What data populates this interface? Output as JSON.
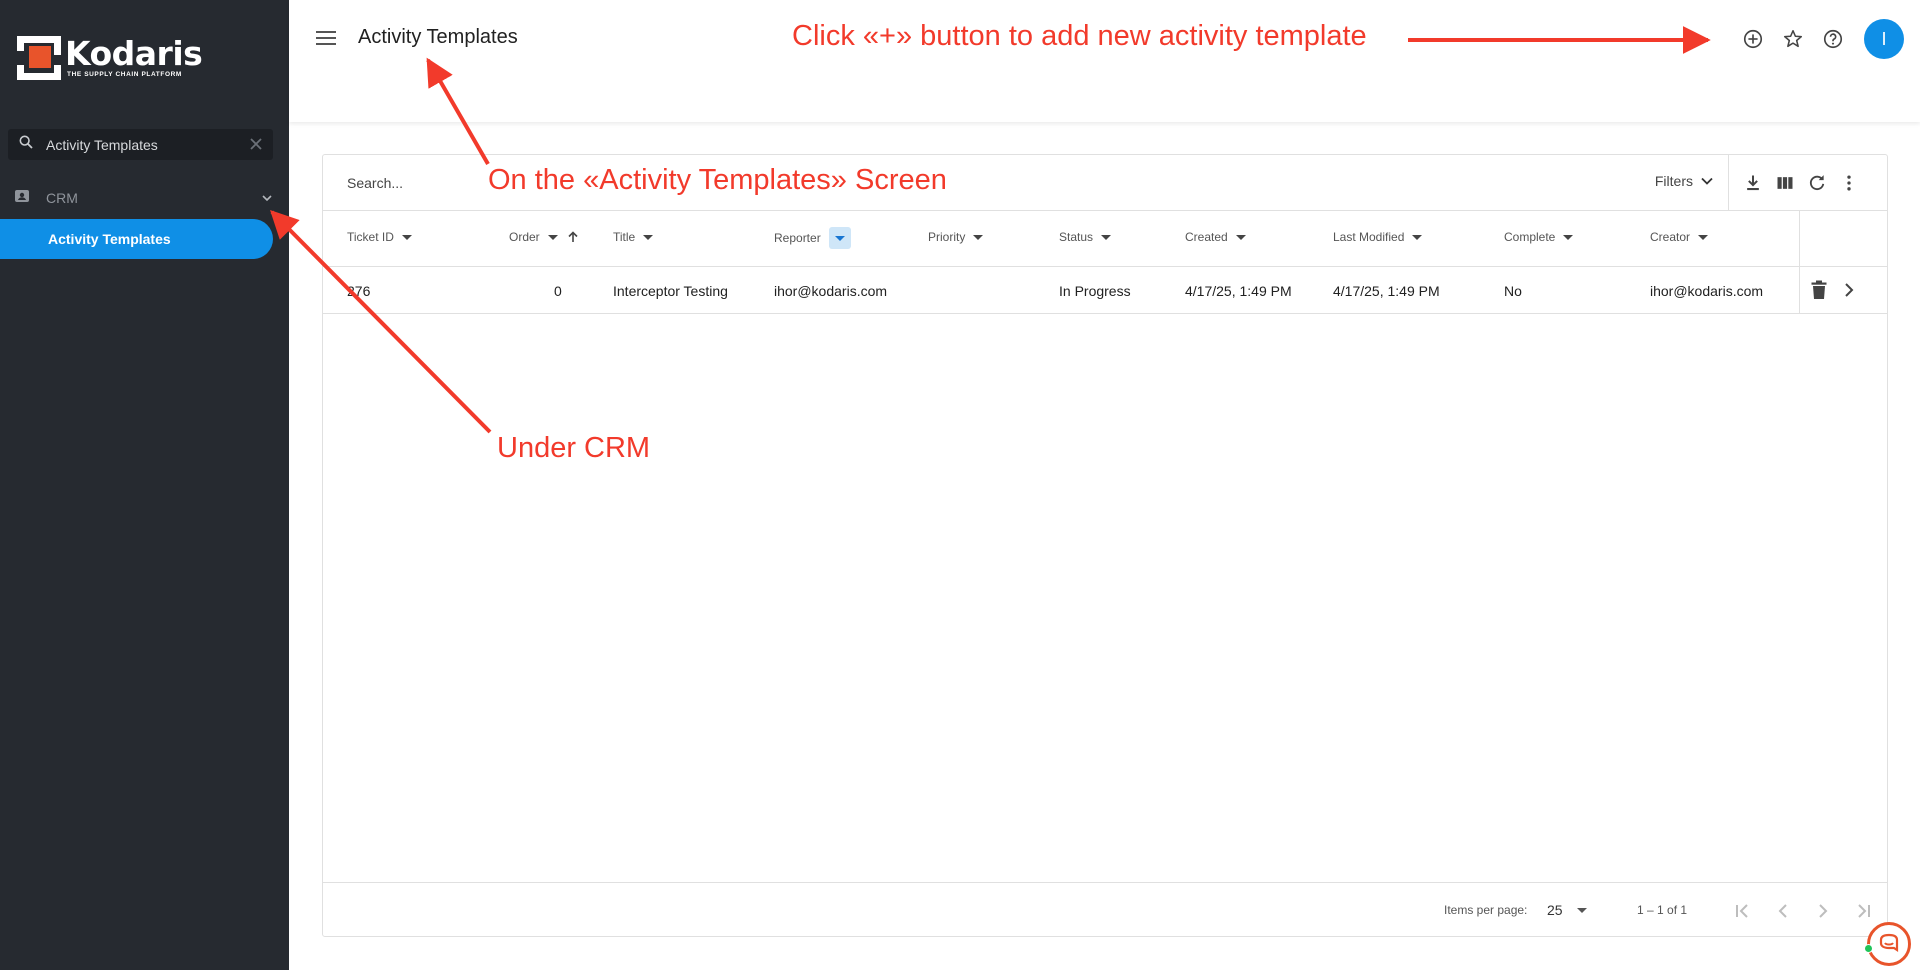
{
  "app": {
    "logo_name": "Kodaris",
    "logo_tagline": "THE SUPPLY CHAIN PLATFORM",
    "brand_color": "#0f8fe6",
    "sidebar_color": "#262a30"
  },
  "sidebar": {
    "search_value": "Activity Templates",
    "section_label": "CRM",
    "active_item": "Activity Templates"
  },
  "header": {
    "title": "Activity Templates",
    "avatar_initial": "I"
  },
  "toolbar": {
    "search_placeholder": "Search...",
    "filters_label": "Filters"
  },
  "table": {
    "columns": [
      "Ticket ID",
      "Order",
      "Title",
      "Reporter",
      "Priority",
      "Status",
      "Created",
      "Last Modified",
      "Complete",
      "Creator"
    ],
    "rows": [
      {
        "ticket_id": "276",
        "order": "0",
        "title": "Interceptor Testing",
        "reporter": "ihor@kodaris.com",
        "priority": "",
        "status": "In Progress",
        "created": "4/17/25, 1:49 PM",
        "last_modified": "4/17/25, 1:49 PM",
        "complete": "No",
        "creator": "ihor@kodaris.com"
      }
    ]
  },
  "pagination": {
    "items_per_page_label": "Items per page:",
    "items_per_page": "25",
    "range": "1 – 1 of 1"
  },
  "annotations": {
    "add_hint": "Click «+» button  to add new activity template",
    "screen_hint": "On the «Activity Templates» Screen",
    "crm_hint": "Under CRM",
    "color": "#f23a2b"
  }
}
